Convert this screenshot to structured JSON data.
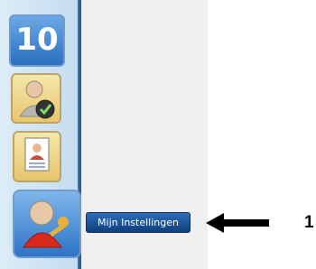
{
  "sidebar": {
    "apps": [
      {
        "label": "10",
        "icon": "office-10-icon"
      },
      {
        "icon": "user-approved-icon"
      },
      {
        "icon": "profile-card-icon"
      },
      {
        "icon": "my-settings-icon"
      }
    ]
  },
  "tooltip": {
    "label": "Mijn Instellingen"
  },
  "annotation": {
    "number": "1",
    "icon": "left-arrow-icon"
  },
  "colors": {
    "sidebar_bg": "#c3dcef",
    "sidebar_edge": "#264f82",
    "tooltip_bg": "#1a4f93",
    "tile_gold": "#e9c66e",
    "tile_blue": "#2e74c6"
  }
}
